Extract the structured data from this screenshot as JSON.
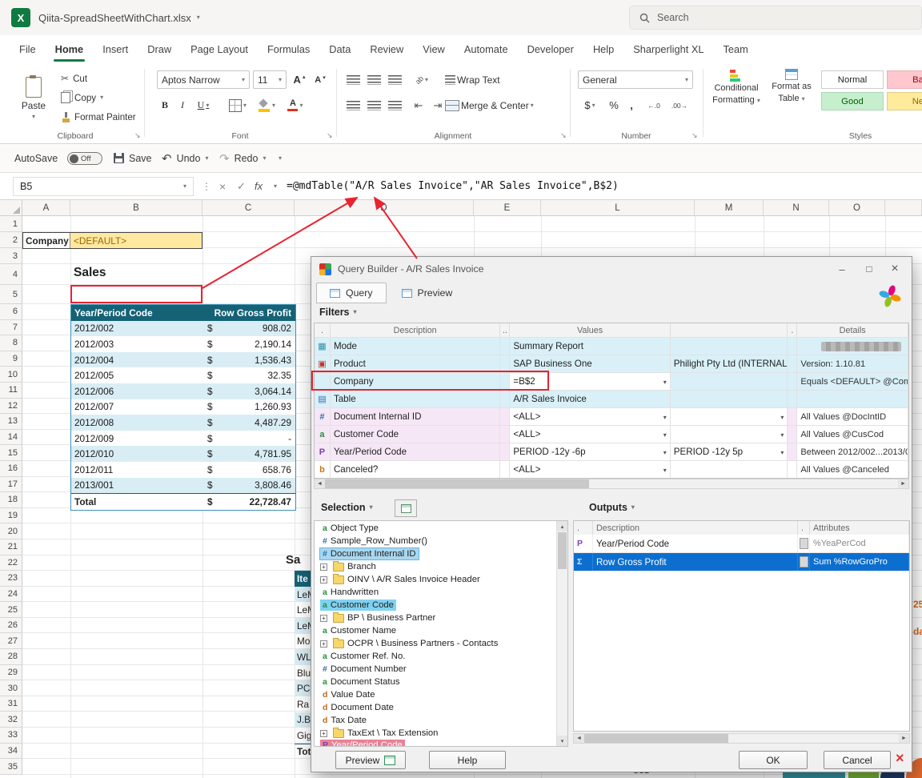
{
  "titlebar": {
    "file_name": "Qiita-SpreadSheetWithChart.xlsx",
    "search_placeholder": "Search"
  },
  "menu": {
    "tabs": [
      {
        "label": "File"
      },
      {
        "label": "Home",
        "active": true
      },
      {
        "label": "Insert"
      },
      {
        "label": "Draw"
      },
      {
        "label": "Page Layout"
      },
      {
        "label": "Formulas"
      },
      {
        "label": "Data"
      },
      {
        "label": "Review"
      },
      {
        "label": "View"
      },
      {
        "label": "Automate"
      },
      {
        "label": "Developer"
      },
      {
        "label": "Help"
      },
      {
        "label": "Sharperlight XL"
      },
      {
        "label": "Team"
      }
    ]
  },
  "ribbon": {
    "clipboard": {
      "group": "Clipboard",
      "paste": "Paste",
      "cut": "Cut",
      "copy": "Copy",
      "format_painter": "Format Painter"
    },
    "font": {
      "group": "Font",
      "name": "Aptos Narrow",
      "size": "11",
      "bold": "B",
      "italic": "I",
      "underline": "U"
    },
    "alignment": {
      "group": "Alignment",
      "wrap": "Wrap Text",
      "merge": "Merge & Center"
    },
    "number": {
      "group": "Number",
      "format": "General"
    },
    "styles": {
      "group": "Styles",
      "conditional_line1": "Conditional",
      "conditional_line2": "Formatting",
      "format_table_line1": "Format as",
      "format_table_line2": "Table",
      "cells": [
        {
          "label": "Normal",
          "kind": "normal"
        },
        {
          "label": "Ba",
          "kind": "bad"
        },
        {
          "label": "Good",
          "kind": "good"
        },
        {
          "label": "Ne",
          "kind": "neutral"
        }
      ]
    }
  },
  "quickbar": {
    "autosave": "AutoSave",
    "autosave_state": "Off",
    "save": "Save",
    "undo": "Undo",
    "redo": "Redo"
  },
  "formula_bar": {
    "name_box": "B5",
    "fx": "fx",
    "formula": "=@mdTable(\"A/R Sales Invoice\",\"AR Sales Invoice\",B$2)"
  },
  "sheet": {
    "columns": [
      {
        "label": "A"
      },
      {
        "label": "B"
      },
      {
        "label": "C"
      },
      {
        "label": "D"
      },
      {
        "label": "E"
      },
      {
        "label": "L"
      },
      {
        "label": "M"
      },
      {
        "label": "N"
      },
      {
        "label": "O"
      },
      {
        "label": ""
      }
    ],
    "row_numbers": [
      {
        "n": "1"
      },
      {
        "n": "2"
      },
      {
        "n": "3"
      },
      {
        "n": "4"
      },
      {
        "n": "5"
      },
      {
        "n": "6"
      },
      {
        "n": "7"
      },
      {
        "n": "8"
      },
      {
        "n": "9"
      },
      {
        "n": "10"
      },
      {
        "n": "11"
      },
      {
        "n": "12"
      },
      {
        "n": "13"
      },
      {
        "n": "14"
      },
      {
        "n": "15"
      },
      {
        "n": "16"
      },
      {
        "n": "17"
      },
      {
        "n": "18"
      },
      {
        "n": "19"
      },
      {
        "n": "20"
      },
      {
        "n": "21"
      },
      {
        "n": "22"
      },
      {
        "n": "23"
      },
      {
        "n": "24"
      },
      {
        "n": "25"
      },
      {
        "n": "26"
      },
      {
        "n": "27"
      },
      {
        "n": "28"
      },
      {
        "n": "29"
      },
      {
        "n": "30"
      },
      {
        "n": "31"
      },
      {
        "n": "32"
      },
      {
        "n": "33"
      },
      {
        "n": "34"
      },
      {
        "n": "35"
      }
    ],
    "company_label": "Company",
    "company_value": "<DEFAULT>",
    "sales_title": "Sales",
    "profit_table": {
      "header_period": "Year/Period Code",
      "header_profit": "Row Gross Profit",
      "currency": "$",
      "rows": [
        {
          "period": "2012/002",
          "amount": "908.02"
        },
        {
          "period": "2012/003",
          "amount": "2,190.14"
        },
        {
          "period": "2012/004",
          "amount": "1,536.43"
        },
        {
          "period": "2012/005",
          "amount": "32.35"
        },
        {
          "period": "2012/006",
          "amount": "3,064.14"
        },
        {
          "period": "2012/007",
          "amount": "1,260.93"
        },
        {
          "period": "2012/008",
          "amount": "4,487.29"
        },
        {
          "period": "2012/009",
          "amount": "-"
        },
        {
          "period": "2012/010",
          "amount": "4,781.95"
        },
        {
          "period": "2012/011",
          "amount": "658.76"
        },
        {
          "period": "2013/001",
          "amount": "3,808.46"
        }
      ],
      "total_label": "Total",
      "total_amount": "22,728.47"
    },
    "item_table": {
      "title_fragment": "Sa",
      "header_fragment": "Ite",
      "rows": [
        {
          "text": "LeM"
        },
        {
          "text": "LeM"
        },
        {
          "text": "LeM"
        },
        {
          "text": "Mo"
        },
        {
          "text": "WL"
        },
        {
          "text": "Blu"
        },
        {
          "text": "PC"
        },
        {
          "text": "Ra"
        },
        {
          "text": "J.B"
        },
        {
          "text": "Gig"
        }
      ],
      "total_fragment": "Tot"
    },
    "edge_fragments": [
      {
        "text": "25"
      },
      {
        "text": "da"
      }
    ],
    "bottom_label": "SSD"
  },
  "dialog": {
    "title": "Query Builder - A/R Sales Invoice",
    "tabs": [
      {
        "label": "Query",
        "active": true
      },
      {
        "label": "Preview"
      }
    ],
    "filters": {
      "label": "Filters",
      "headers": {
        "c1": ".",
        "c2": "Description",
        "c3": "..",
        "c4": "Values",
        "c5": "",
        "c6": ".",
        "c7": "Details"
      },
      "rows": [
        {
          "icon": "mode",
          "glyph": "▦",
          "description": "Mode",
          "value": "Summary Report",
          "value2": "",
          "details": "",
          "redacted": true,
          "tint": "cyan"
        },
        {
          "icon": "product",
          "glyph": "▣",
          "description": "Product",
          "value": "SAP Business One",
          "value2": "Philight Pty Ltd (INTERNAL ...",
          "details": "Version: 1.10.81",
          "tint": "cyan"
        },
        {
          "icon": "none",
          "glyph": "",
          "description": "Company",
          "value": "=B$2",
          "value2": "",
          "details": "Equals <DEFAULT> @Comp...",
          "tint": "cyan",
          "value_caret": true
        },
        {
          "icon": "table",
          "glyph": "▤",
          "description": "Table",
          "value": "A/R Sales Invoice",
          "value2": "",
          "details": "",
          "tint": "cyan"
        },
        {
          "icon": "number",
          "glyph": "#",
          "description": "Document Internal ID",
          "value": "<ALL>",
          "value2": "",
          "details": "All Values @DocIntID",
          "tint": "pink",
          "value_caret": true,
          "value2_caret": true
        },
        {
          "icon": "text",
          "glyph": "a",
          "description": "Customer Code",
          "value": "<ALL>",
          "value2": "",
          "details": "All Values @CusCod",
          "tint": "pink",
          "value_caret": true,
          "value2_caret": true
        },
        {
          "icon": "period",
          "glyph": "P",
          "description": "Year/Period Code",
          "value": "PERIOD -12y -6p",
          "value2": "PERIOD -12y 5p",
          "details": "Between 2012/002...2013/0...",
          "tint": "pink",
          "value_caret": true,
          "value2_caret": true
        },
        {
          "icon": "bool",
          "glyph": "b",
          "description": "Canceled?",
          "value": "<ALL>",
          "value2": "",
          "details": "All Values @Canceled",
          "tint": "white",
          "value_caret": true
        }
      ]
    },
    "selection": {
      "label": "Selection",
      "tree": [
        {
          "icon": "text",
          "glyph": "a",
          "label": "Object Type"
        },
        {
          "icon": "number",
          "glyph": "#",
          "label": "Sample_Row_Number()"
        },
        {
          "icon": "number",
          "glyph": "#",
          "label": "Document Internal ID",
          "highlight": "blue"
        },
        {
          "icon": "folder",
          "glyph": "",
          "label": "Branch",
          "expander": true
        },
        {
          "icon": "folder",
          "glyph": "",
          "label": "OINV \\ A/R Sales Invoice Header",
          "expander": true
        },
        {
          "icon": "text",
          "glyph": "a",
          "label": "Handwritten"
        },
        {
          "icon": "text",
          "glyph": "a",
          "label": "Customer Code",
          "highlight": "cyan"
        },
        {
          "icon": "folder",
          "glyph": "",
          "label": "BP \\ Business Partner",
          "expander": true
        },
        {
          "icon": "text",
          "glyph": "a",
          "label": "Customer Name"
        },
        {
          "icon": "folder",
          "glyph": "",
          "label": "OCPR \\ Business Partners - Contacts",
          "expander": true
        },
        {
          "icon": "text",
          "glyph": "a",
          "label": "Customer Ref. No."
        },
        {
          "icon": "number",
          "glyph": "#",
          "label": "Document Number"
        },
        {
          "icon": "text",
          "glyph": "a",
          "label": "Document Status"
        },
        {
          "icon": "date",
          "glyph": "d",
          "label": "Value Date"
        },
        {
          "icon": "date",
          "glyph": "d",
          "label": "Document Date"
        },
        {
          "icon": "date",
          "glyph": "d",
          "label": "Tax Date"
        },
        {
          "icon": "folder",
          "glyph": "",
          "label": "TaxExt \\ Tax Extension",
          "expander": true
        },
        {
          "icon": "period",
          "glyph": "P",
          "label": "Year/Period Code",
          "highlight": "pink",
          "partial": true
        }
      ]
    },
    "outputs": {
      "label": "Outputs",
      "headers": {
        "c1": ".",
        "c2": "Description",
        "c3": ".",
        "c4": "Attributes"
      },
      "rows": [
        {
          "icon": "period",
          "glyph": "P",
          "description": "Year/Period Code",
          "attributes": "%YeaPerCod"
        },
        {
          "icon": "sum",
          "glyph": "Σ",
          "description": "Row Gross Profit",
          "attributes": "Sum %RowGroPro",
          "selected": true
        }
      ]
    },
    "buttons": {
      "preview": "Preview",
      "help": "Help",
      "ok": "OK",
      "cancel": "Cancel"
    }
  }
}
